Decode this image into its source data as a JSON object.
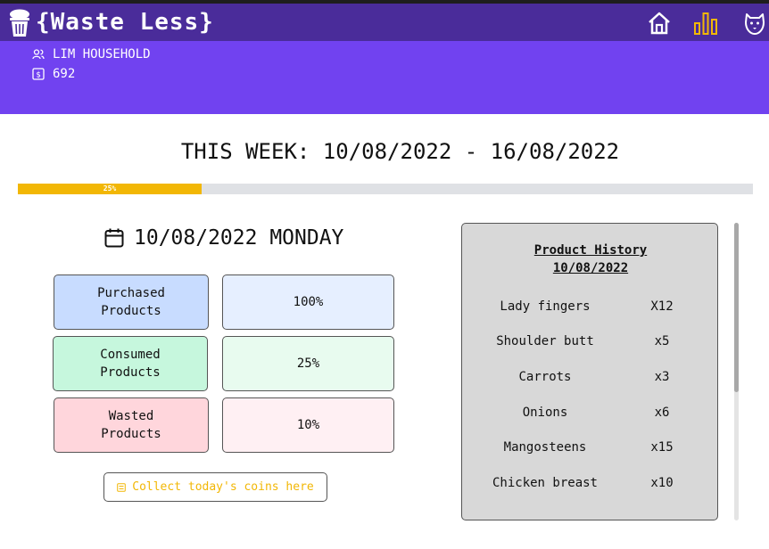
{
  "header": {
    "brand": "{Waste Less}",
    "icons": [
      "trash-icon",
      "home-icon",
      "bar-chart-icon",
      "dog-icon"
    ],
    "accent_color": "#4a2c9a",
    "sub_color": "#7142f0"
  },
  "household": {
    "name": "LIM HOUSEHOLD",
    "coins": "692"
  },
  "week": {
    "title": "THIS WEEK: 10/08/2022 - 16/08/2022",
    "progress_label": "25%",
    "progress_value": 0.25,
    "progress_color": "#f2b705"
  },
  "day": {
    "title": "10/08/2022 MONDAY"
  },
  "stats": {
    "purchased_label": "Purchased Products",
    "purchased_value": "100%",
    "consumed_label": "Consumed Products",
    "consumed_value": "25%",
    "wasted_label": "Wasted Products",
    "wasted_value": "10%"
  },
  "collect": {
    "label": "Collect today's coins here"
  },
  "history": {
    "title_line1": "Product History",
    "title_line2": "10/08/2022",
    "items": [
      {
        "name": "Lady fingers",
        "qty": "X12"
      },
      {
        "name": "Shoulder butt",
        "qty": "x5"
      },
      {
        "name": "Carrots",
        "qty": "x3"
      },
      {
        "name": "Onions",
        "qty": "x6"
      },
      {
        "name": "Mangosteens",
        "qty": "x15"
      },
      {
        "name": "Chicken breast",
        "qty": "x10"
      }
    ]
  }
}
